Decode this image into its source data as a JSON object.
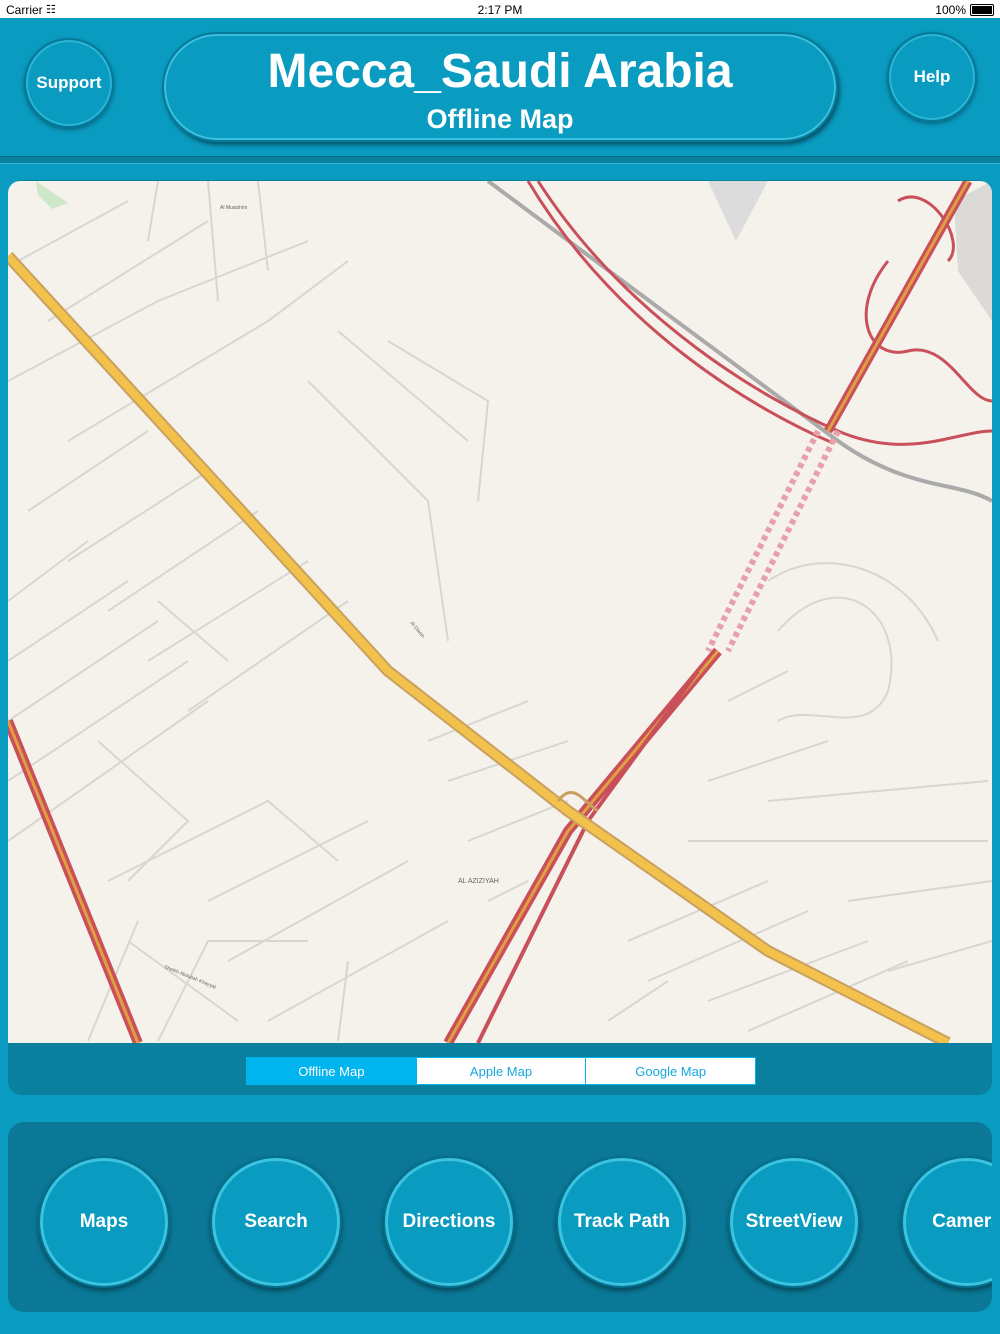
{
  "status_bar": {
    "carrier": "Carrier",
    "time": "2:17 PM",
    "battery": "100%"
  },
  "header": {
    "support_label": "Support",
    "help_label": "Help",
    "title": "Mecca_Saudi Arabia",
    "subtitle": "Offline Map"
  },
  "map": {
    "labels": {
      "district": "AL AZIZIYAH",
      "area_top": "Al Muaishim",
      "street_1": "Al Diwan",
      "street_2": "Sheikh Abdullah Khayyat"
    }
  },
  "map_modes": {
    "options": [
      "Offline Map",
      "Apple Map",
      "Google Map"
    ],
    "selected": "Offline Map"
  },
  "toolbar": {
    "items": [
      "Maps",
      "Search",
      "Directions",
      "Track Path",
      "StreetView",
      "Camera"
    ]
  },
  "colors": {
    "background": "#0a9bc0",
    "panel": "#0a7896",
    "map_bg": "#f5f2ec",
    "motorway": "#d0565f",
    "trunk": "#f2c24c",
    "segment_active": "#00b4ee"
  }
}
